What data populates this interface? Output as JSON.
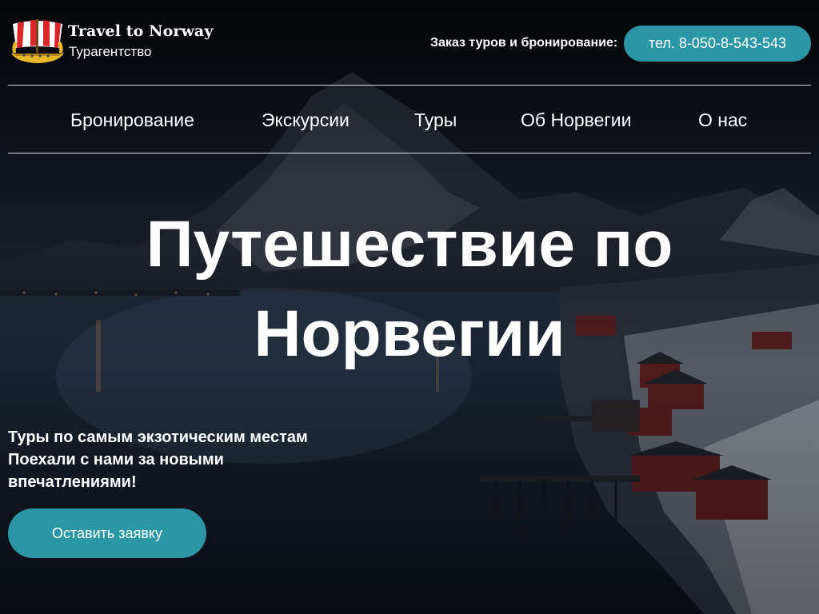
{
  "brand": {
    "title": "Travel to Norway",
    "subtitle": "Турагентство",
    "logo_icon": "viking-ship-icon"
  },
  "header": {
    "order_label": "Заказ туров и бронирование:",
    "phone_button": "тел. 8-050-8-543-543"
  },
  "nav": {
    "items": [
      {
        "label": "Бронирование"
      },
      {
        "label": "Экскурсии"
      },
      {
        "label": "Туры"
      },
      {
        "label": "Об Норвегии"
      },
      {
        "label": "О нас"
      }
    ]
  },
  "hero": {
    "title_line1": "Путешествие по",
    "title_line2": "Норвегии",
    "tagline_line1": "Туры по самым экзотическим местам",
    "tagline_line2": "Поехали с нами за новыми",
    "tagline_line3": "впечатлениями!",
    "cta_label": "Оставить заявку"
  },
  "colors": {
    "accent": "#2b97a6",
    "text": "#ffffff",
    "overlay": "#0a0c12"
  }
}
